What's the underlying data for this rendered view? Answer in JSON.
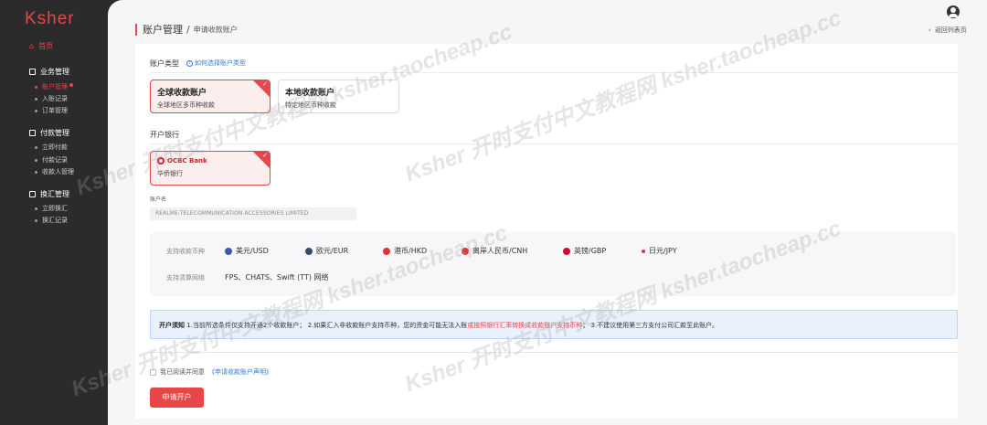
{
  "sidebar": {
    "logo": "Ksher",
    "home": "首页",
    "groups": [
      {
        "label": "业务管理",
        "items": [
          "账户管理",
          "入账记录",
          "订单管理"
        ]
      },
      {
        "label": "付款管理",
        "items": [
          "立即付款",
          "付款记录",
          "收款人管理"
        ]
      },
      {
        "label": "换汇管理",
        "items": [
          "立即换汇",
          "换汇记录"
        ]
      }
    ]
  },
  "header": {
    "title": "账户管理",
    "separator": "/",
    "subtitle": "申请收款账户",
    "back": "返回列表页"
  },
  "account_type": {
    "label": "账户类型",
    "help": "如何选择账户类型",
    "options": [
      {
        "title": "全球收款账户",
        "desc": "全球地区多币种收款",
        "selected": true
      },
      {
        "title": "本地收款账户",
        "desc": "特定地区币种收款",
        "selected": false
      }
    ]
  },
  "bank": {
    "label": "开户银行",
    "logo_text": "OCBC Bank",
    "name": "华侨银行"
  },
  "account_name": {
    "label": "账户名",
    "value": "REALME-TELECOMMUNICATION ACCESSORIES LIMITED"
  },
  "currencies": {
    "label": "支持收款币种",
    "items": [
      {
        "name": "美元/USD",
        "color": "#3c5aa8"
      },
      {
        "name": "欧元/EUR",
        "color": "#3a4a6a"
      },
      {
        "name": "港币/HKD",
        "color": "#e0323a"
      },
      {
        "name": "离岸人民币/CNH",
        "color": "#e0323a"
      },
      {
        "name": "英镑/GBP",
        "color": "#c8102e"
      },
      {
        "name": "日元/JPY",
        "color": "#e0323a"
      }
    ],
    "network_label": "支持清算网络",
    "network_value": "FPS、CHATS、Swift (TT) 网络"
  },
  "notice": {
    "title": "开户须知",
    "part1": " 1.当前所选条件仅支持开通2个收款账户； 2.如果汇入非收款账户支持币种，您的资金可能无法入账",
    "red": "或按照银行汇率转换成收款账户支持币种",
    "part2": "； 3.不建议使用第三方支付公司汇款至此账户。"
  },
  "agreement": {
    "text": "我已阅读并同意",
    "link": "《申请收款账户声明》"
  },
  "submit_label": "申请开户",
  "watermark": "Ksher 开时支付中文教程网 ksher.taocheap.cc",
  "colors": {
    "accent": "#e6474b",
    "link": "#2f7de1",
    "sidebar_bg": "#2b2b2b"
  }
}
